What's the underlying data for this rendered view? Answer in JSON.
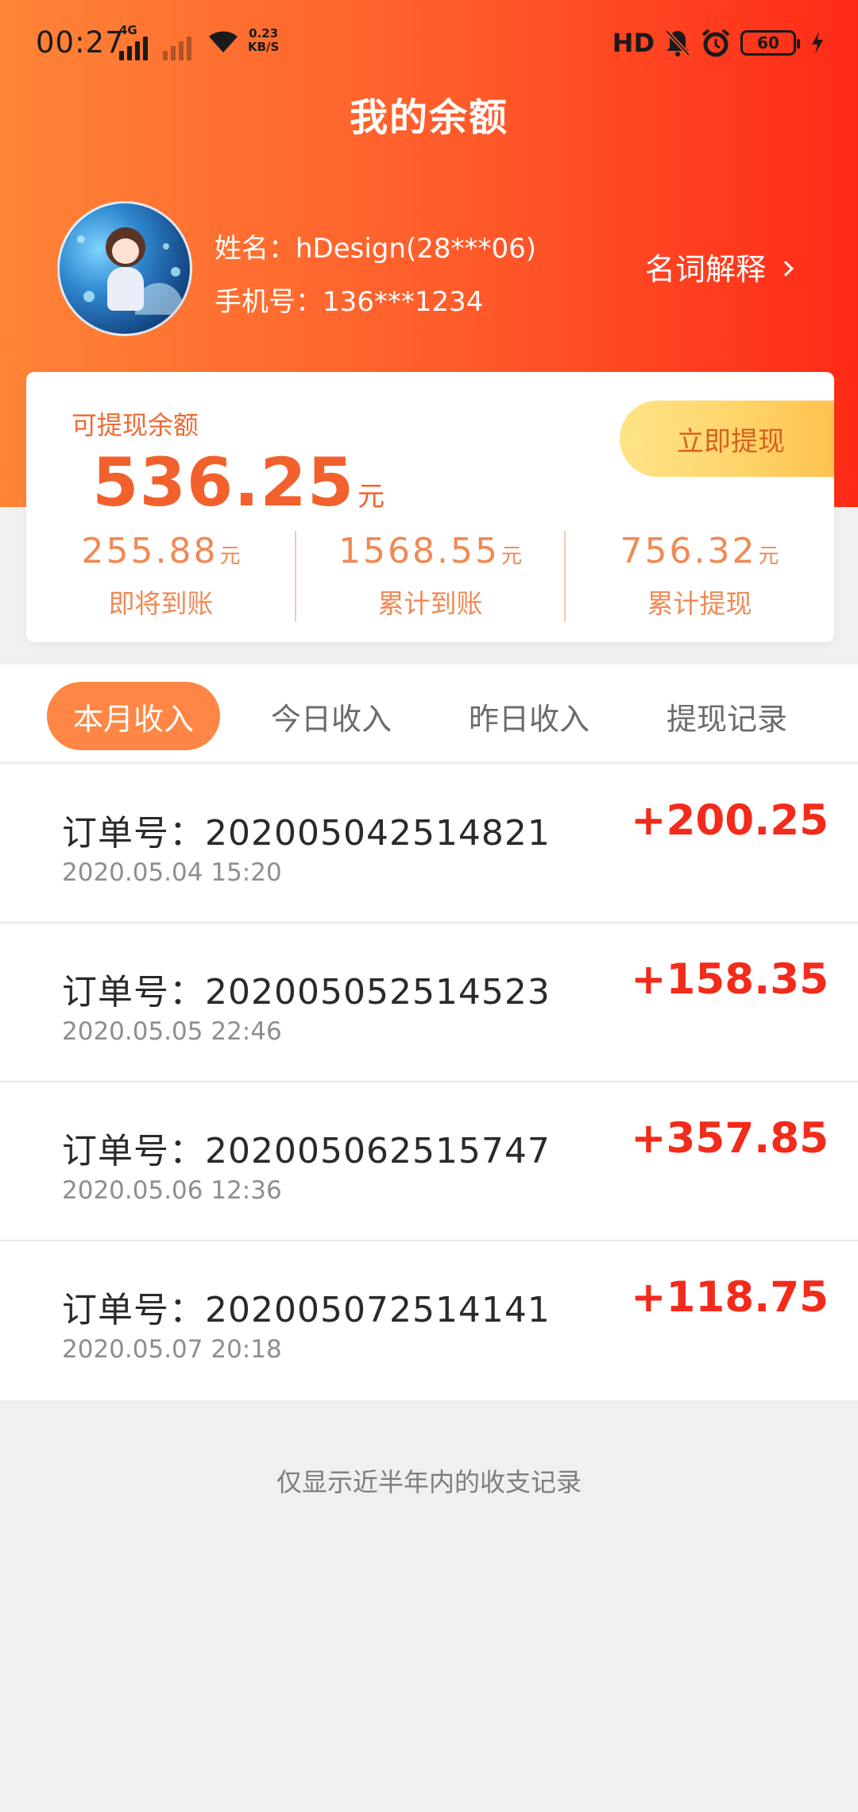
{
  "status_bar": {
    "time": "00:27",
    "network_tag": "4G",
    "speed_value": "0.23",
    "speed_unit": "KB/S",
    "hd_label": "HD",
    "battery": "60",
    "icons": [
      "signal-icon",
      "wifi-icon",
      "mute-bell-icon",
      "alarm-icon",
      "battery-icon",
      "charging-icon"
    ]
  },
  "header": {
    "title": "我的余额",
    "name_line": "姓名：hDesign(28***06)",
    "phone_line": "手机号：136***1234",
    "glossary_label": "名词解释"
  },
  "balance_card": {
    "label": "可提现余额",
    "amount": "536.25",
    "unit": "元",
    "withdraw_button": "立即提现",
    "stats": [
      {
        "value": "255.88",
        "unit": "元",
        "label": "即将到账"
      },
      {
        "value": "1568.55",
        "unit": "元",
        "label": "累计到账"
      },
      {
        "value": "756.32",
        "unit": "元",
        "label": "累计提现"
      }
    ]
  },
  "tabs": [
    {
      "label": "本月收入",
      "active": true
    },
    {
      "label": "今日收入",
      "active": false
    },
    {
      "label": "昨日收入",
      "active": false
    },
    {
      "label": "提现记录",
      "active": false
    }
  ],
  "records": [
    {
      "order": "订单号：202005042514821",
      "time": "2020.05.04 15:20",
      "amount": "+200.25"
    },
    {
      "order": "订单号：202005052514523",
      "time": "2020.05.05 22:46",
      "amount": "+158.35"
    },
    {
      "order": "订单号：202005062515747",
      "time": "2020.05.06 12:36",
      "amount": "+357.85"
    },
    {
      "order": "订单号：202005072514141",
      "time": "2020.05.07 20:18",
      "amount": "+118.75"
    }
  ],
  "footnote": "仅显示近半年内的收支记录",
  "colors": {
    "header_start": "#ff8436",
    "header_end": "#ff2a16",
    "accent_orange": "#f2602c",
    "amount_red": "#f22b1b",
    "tab_active": "#ff8644"
  }
}
